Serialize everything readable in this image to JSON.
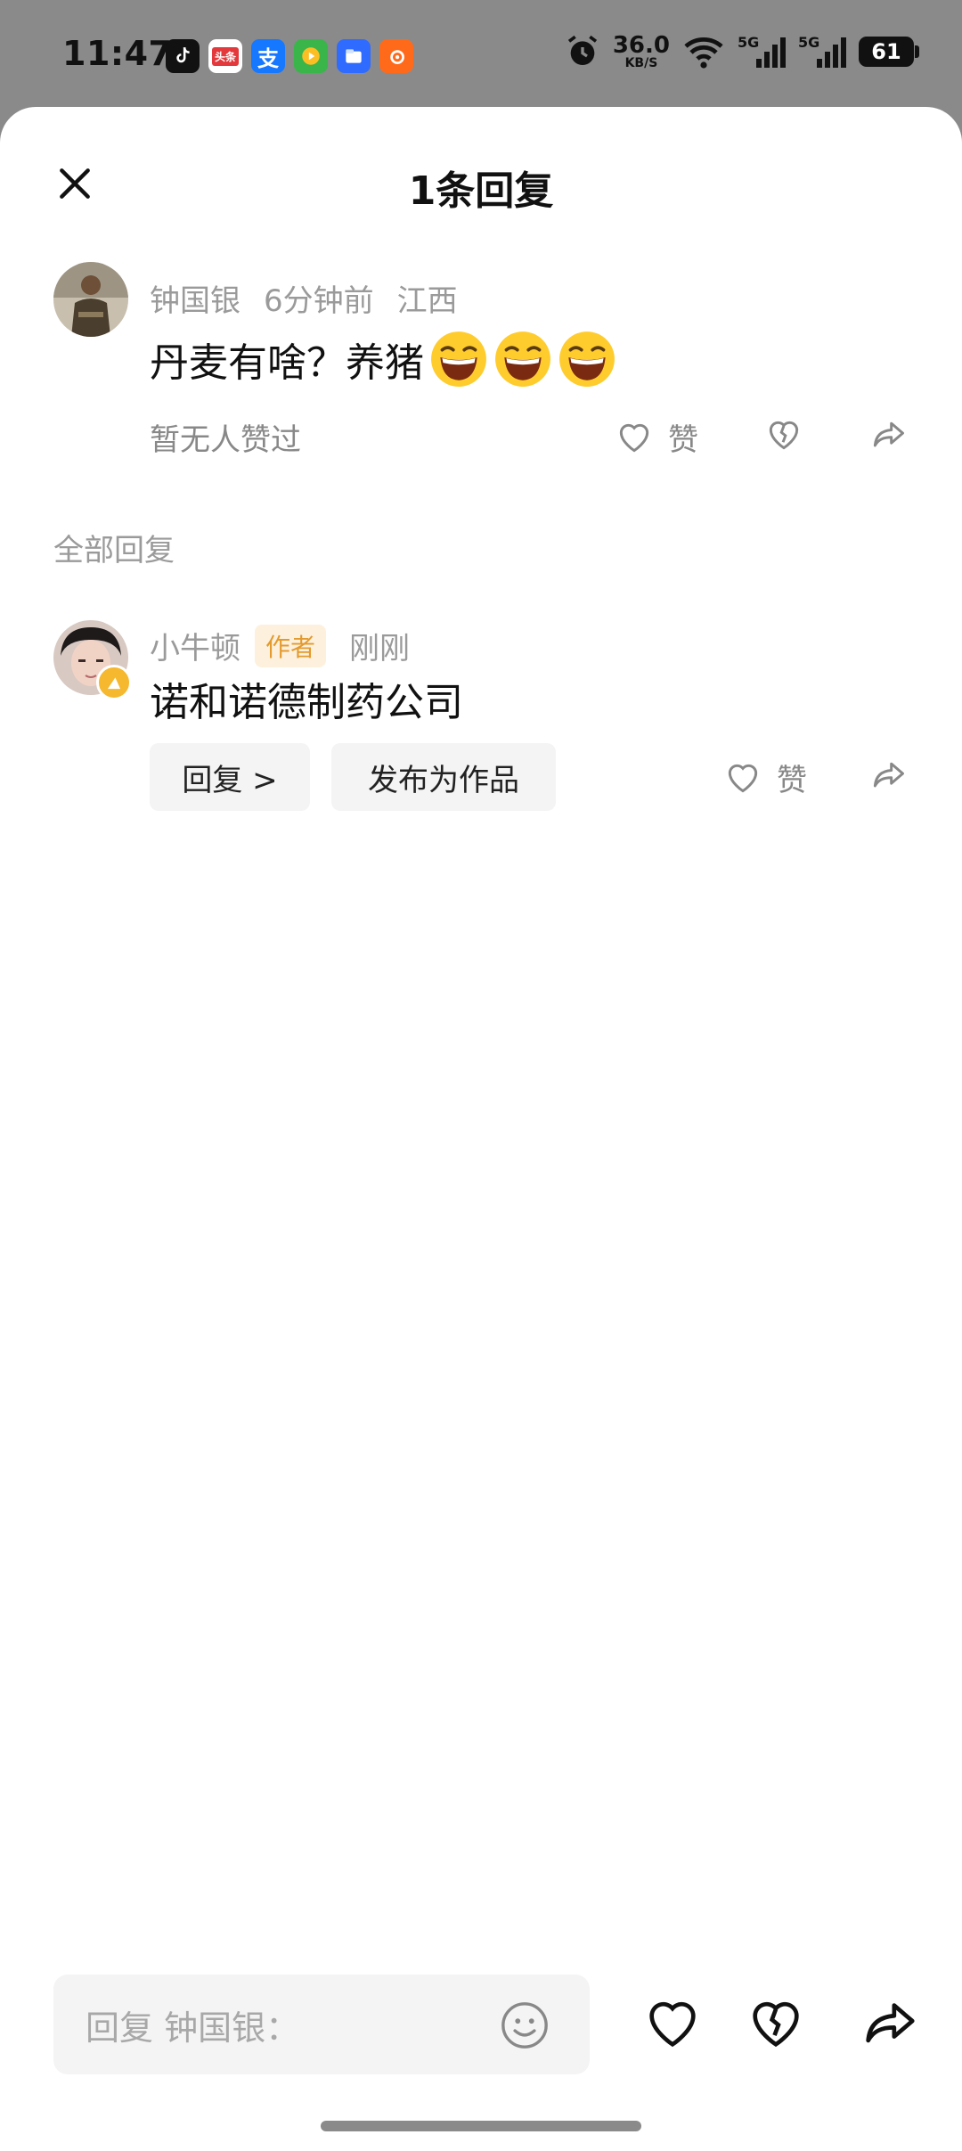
{
  "status_bar": {
    "time": "11:47",
    "net_speed_value": "36.0",
    "net_speed_unit": "KB/S",
    "sig1_type": "5G",
    "sig2_type": "5G",
    "battery": "61",
    "toutiao_label": "头条",
    "alipay_label": "支"
  },
  "sheet": {
    "title": "1条回复",
    "close_icon": "close-icon"
  },
  "main_comment": {
    "username": "钟国银",
    "time": "6分钟前",
    "location": "江西",
    "text": "丹麦有啥？养猪",
    "emoji_count": 3,
    "no_likes": "暂无人赞过",
    "like_label": "赞"
  },
  "replies_section": {
    "label": "全部回复"
  },
  "reply": {
    "username": "小牛顿",
    "badge": "作者",
    "time": "刚刚",
    "text": "诺和诺德制药公司",
    "reply_button": "回复 >",
    "publish_button": "发布为作品",
    "like_label": "赞"
  },
  "bottom_bar": {
    "placeholder": "回复 钟国银："
  },
  "colors": {
    "accent_badge_bg": "#fdf1dd",
    "accent_badge_text": "#e49a2e",
    "muted_text": "#9a9a9a"
  }
}
